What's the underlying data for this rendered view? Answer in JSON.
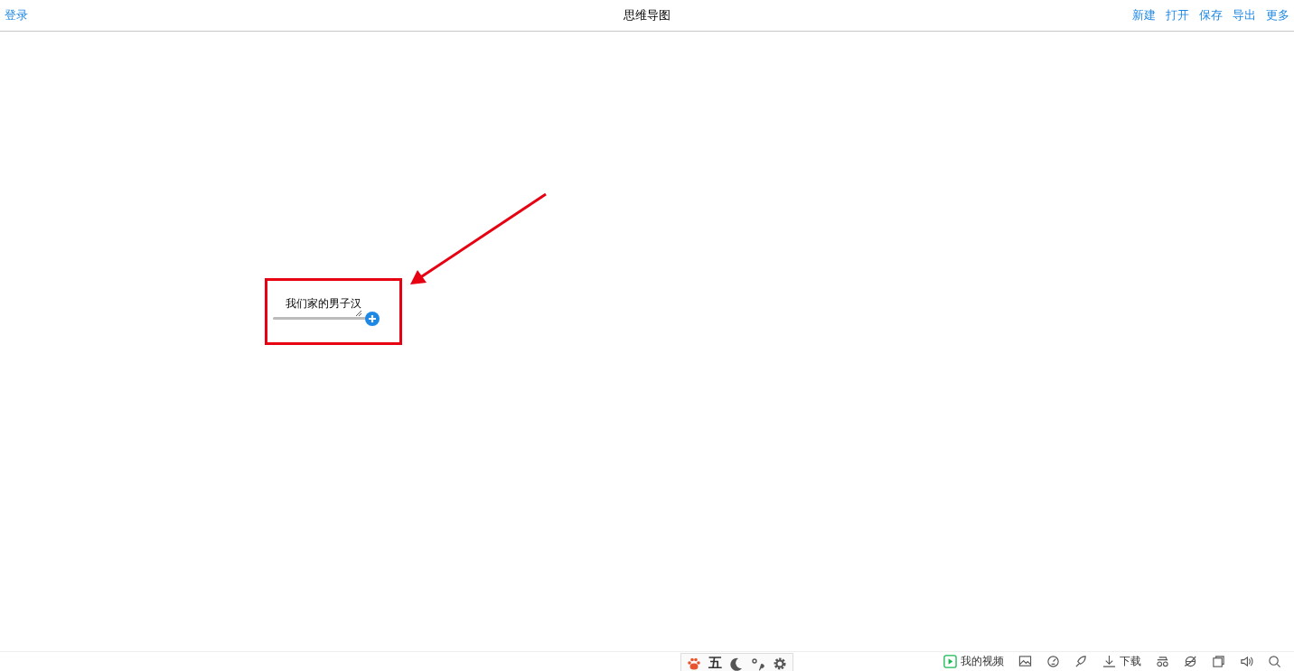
{
  "header": {
    "login": "登录",
    "title": "思维导图",
    "actions": [
      "新建",
      "打开",
      "保存",
      "导出",
      "更多"
    ]
  },
  "canvas": {
    "root_node": {
      "text": "我们家的男子汉"
    }
  },
  "ime_toolbar": {
    "mode": "五"
  },
  "status_bar": {
    "video": "我的视频",
    "download": "下载"
  }
}
